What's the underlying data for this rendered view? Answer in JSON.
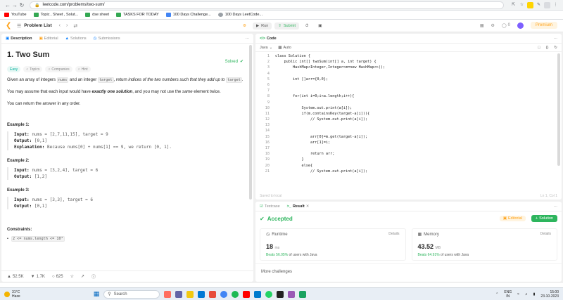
{
  "browser": {
    "url": "leetcode.com/problems/two-sum/",
    "bookmarks": [
      {
        "label": "YouTube",
        "color": "#ff0000"
      },
      {
        "label": "Topic , Sheet , Solut...",
        "color": "#34a853"
      },
      {
        "label": "dse sheet",
        "color": "#34a853"
      },
      {
        "label": "TASKS FOR TODAY",
        "color": "#34a853"
      },
      {
        "label": "100 Days Challenge...",
        "color": "#4285f4"
      },
      {
        "label": "100 Days LeetCode...",
        "color": "#9aa0a6"
      }
    ]
  },
  "header": {
    "problem_list": "Problem List",
    "run": "Run",
    "submit": "Submit",
    "streak": "0",
    "premium": "Premium"
  },
  "left": {
    "tabs": [
      "Description",
      "Editorial",
      "Solutions",
      "Submissions"
    ],
    "title": "1. Two Sum",
    "solved": "Solved",
    "chips": [
      "Easy",
      "Topics",
      "Companies",
      "Hint"
    ],
    "p1_a": "Given an array of integers",
    "p1_code1": "nums",
    "p1_b": "and an integer",
    "p1_code2": "target",
    "p1_c": ", return",
    "p1_em": "indices of the two numbers such that they add up to",
    "p1_code3": "target",
    "p1_d": ".",
    "p2_a": "You may assume that each input would have",
    "p2_b": "exactly one solution",
    "p2_c": ", and you may not use the",
    "p2_d": "same",
    "p2_e": "element twice.",
    "p3": "You can return the answer in any order.",
    "examples": [
      {
        "head": "Example 1:",
        "input": "nums = [2,7,11,15], target = 9",
        "output": "[0,1]",
        "explanation": "Because nums[0] + nums[1] == 9, we return [0, 1]."
      },
      {
        "head": "Example 2:",
        "input": "nums = [3,2,4], target = 6",
        "output": "[1,2]"
      },
      {
        "head": "Example 3:",
        "input": "nums = [3,3], target = 6",
        "output": "[0,1]"
      }
    ],
    "labels": {
      "input": "Input:",
      "output": "Output:",
      "explanation": "Explanation:"
    },
    "constraints_head": "Constraints:",
    "constraint1": "2 <= nums.length <= 10⁴",
    "footer": {
      "likes": "52.5K",
      "dislikes": "1.7K",
      "comments": "625"
    }
  },
  "editor": {
    "tab": "Code",
    "language": "Java",
    "mode": "Auto",
    "saved": "Saved to local",
    "cursor": "Ln 1, Col 1",
    "lines": [
      "class Solution {",
      "    public int[] twoSum(int[] a, int target) {",
      "        HashMap<Integer,Integer>m=new HashMap<>();",
      "",
      "        int []arr={0,0};",
      "",
      "",
      "        for(int i=0;i<a.length;i++){",
      "",
      "            System.out.print(a[i]);",
      "            if(m.containsKey(target-a[i])){",
      "                // System.out.print(a[i]);",
      "",
      "",
      "                arr[0]=m.get(target-a[i]);",
      "                arr[1]=i;",
      "",
      "                return arr;",
      "            }",
      "            else{",
      "                // System.out.print(a[i]);"
    ]
  },
  "result": {
    "tabs": [
      "Testcase",
      "Result"
    ],
    "status": "Accepted",
    "editorial": "Editorial",
    "solution": "Solution",
    "runtime_label": "Runtime",
    "runtime_value": "18",
    "runtime_unit": "ms",
    "runtime_beats": "Beats 56.05%",
    "runtime_beats_suffix": "of users with Java",
    "memory_label": "Memory",
    "memory_value": "43.52",
    "memory_unit": "MB",
    "memory_beats": "Beats 64.91%",
    "memory_beats_suffix": "of users with Java",
    "details": "Details",
    "more": "More challenges"
  },
  "taskbar": {
    "weather_temp": "31°C",
    "weather_desc": "Haze",
    "search": "Search",
    "lang": "ENG",
    "lang2": "IN",
    "time": "15:00",
    "date": "23-10-2023"
  }
}
